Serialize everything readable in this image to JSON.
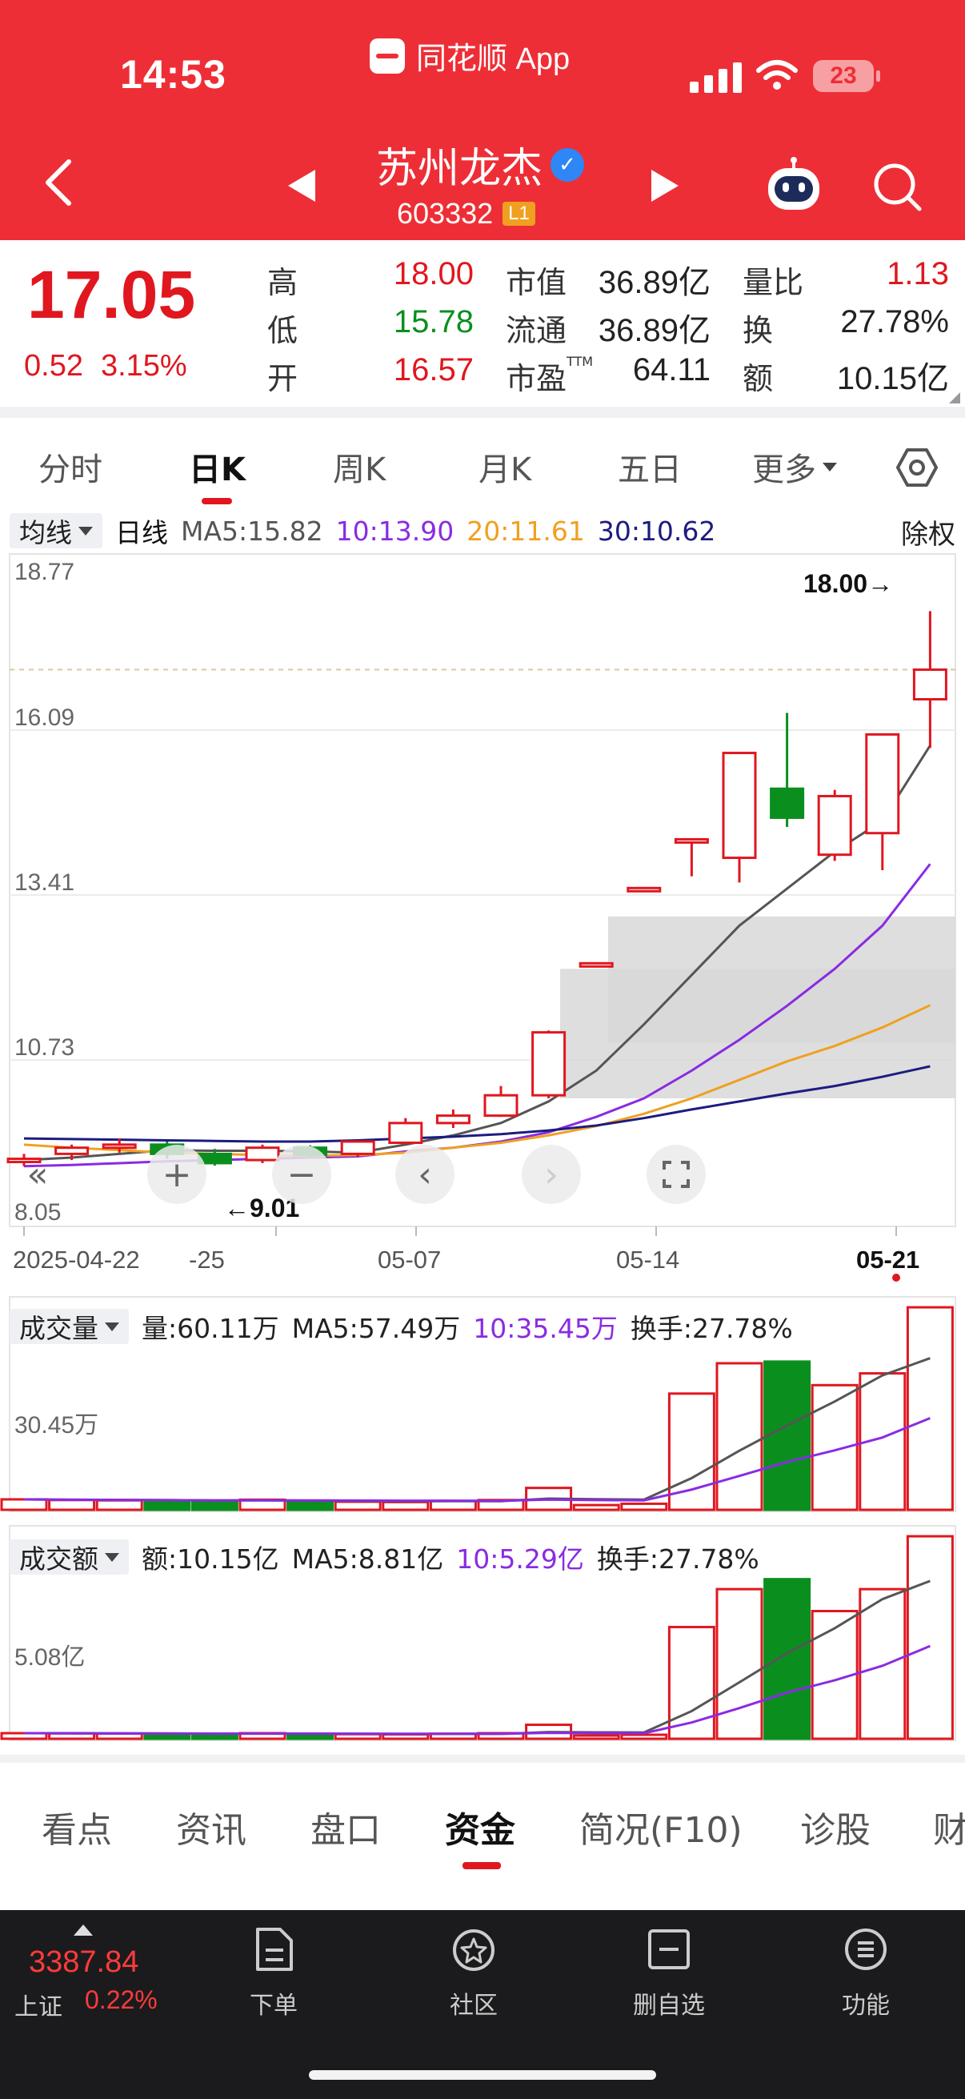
{
  "status_bar": {
    "time": "14:53",
    "app_name": "同花顺 App",
    "battery": "23"
  },
  "header": {
    "stock_name": "苏州龙杰",
    "stock_code": "603332",
    "level_badge": "L1",
    "verified_mark": "✓"
  },
  "quote": {
    "price": "17.05",
    "change": "0.52",
    "change_pct": "3.15%",
    "high_label": "高",
    "high": "18.00",
    "low_label": "低",
    "low": "15.78",
    "open_label": "开",
    "open": "16.57",
    "mcap_label": "市值",
    "mcap": "36.89亿",
    "float_label": "流通",
    "float": "36.89亿",
    "pe_label": "市盈",
    "pe_sup": "TTM",
    "pe": "64.11",
    "volratio_label": "量比",
    "volratio": "1.13",
    "turnover_label": "换",
    "turnover": "27.78%",
    "amount_label": "额",
    "amount": "10.15亿"
  },
  "period_tabs": [
    "分时",
    "日K",
    "周K",
    "月K",
    "五日",
    "更多"
  ],
  "period_active": "日K",
  "kline_legend": {
    "dropdown": "均线",
    "period": "日线",
    "ma5": "MA5:15.82",
    "ma10": "10:13.90",
    "ma20": "20:11.61",
    "ma30": "30:10.62",
    "fuquan": "除权"
  },
  "colors": {
    "up": "#e0171f",
    "down": "#0a8f1e",
    "ma5": "#555555",
    "ma10": "#8a2be2",
    "ma20": "#f0a020",
    "ma30": "#1c1c80",
    "header": "#ee2e36"
  },
  "icons": {
    "back": "chevron-left-icon",
    "prev": "triangle-left-icon",
    "next": "triangle-right-icon",
    "assistant": "robot-icon",
    "search": "search-icon",
    "settings": "hexagon-settings-icon"
  },
  "chart_data": [
    {
      "type": "candlestick",
      "title": "",
      "y_ticks": [
        "18.77",
        "16.09",
        "13.41",
        "10.73",
        "8.05"
      ],
      "ylim": [
        8.05,
        18.77
      ],
      "x_ticks": [
        "2025-04-22",
        "-25",
        "05-07",
        "05-14",
        "05-21"
      ],
      "high_marker": "18.00→",
      "low_marker": "←9.01",
      "candles": [
        {
          "o": 9.1,
          "h": 9.2,
          "l": 9.0,
          "c": 9.12
        },
        {
          "o": 9.2,
          "h": 9.35,
          "l": 9.1,
          "c": 9.3
        },
        {
          "o": 9.3,
          "h": 9.45,
          "l": 9.22,
          "c": 9.35
        },
        {
          "o": 9.35,
          "h": 9.4,
          "l": 9.12,
          "c": 9.2
        },
        {
          "o": 9.2,
          "h": 9.28,
          "l": 9.01,
          "c": 9.05
        },
        {
          "o": 9.1,
          "h": 9.35,
          "l": 9.05,
          "c": 9.3
        },
        {
          "o": 9.3,
          "h": 9.34,
          "l": 9.12,
          "c": 9.18
        },
        {
          "o": 9.2,
          "h": 9.42,
          "l": 9.15,
          "c": 9.4
        },
        {
          "o": 9.38,
          "h": 9.78,
          "l": 9.36,
          "c": 9.7
        },
        {
          "o": 9.7,
          "h": 9.92,
          "l": 9.62,
          "c": 9.82
        },
        {
          "o": 9.82,
          "h": 10.3,
          "l": 9.8,
          "c": 10.15
        },
        {
          "o": 10.15,
          "h": 11.2,
          "l": 10.1,
          "c": 11.17
        },
        {
          "o": 12.28,
          "h": 12.28,
          "l": 12.28,
          "c": 12.29
        },
        {
          "o": 13.5,
          "h": 13.5,
          "l": 13.5,
          "c": 13.51
        },
        {
          "o": 14.3,
          "h": 14.3,
          "l": 13.7,
          "c": 14.3
        },
        {
          "o": 14.0,
          "h": 15.7,
          "l": 13.6,
          "c": 15.7
        },
        {
          "o": 15.12,
          "h": 16.35,
          "l": 14.5,
          "c": 14.65
        },
        {
          "o": 14.05,
          "h": 15.1,
          "l": 13.95,
          "c": 15.0
        },
        {
          "o": 14.4,
          "h": 15.9,
          "l": 13.8,
          "c": 16.0
        },
        {
          "o": 16.57,
          "h": 18.0,
          "l": 15.78,
          "c": 17.05
        }
      ],
      "ma_series": [
        {
          "name": "MA5",
          "values": [
            9.1,
            9.14,
            9.2,
            9.26,
            9.25,
            9.25,
            9.24,
            9.22,
            9.35,
            9.5,
            9.7,
            10.05,
            10.55,
            11.3,
            12.1,
            12.9,
            13.5,
            14.1,
            14.6,
            15.82
          ]
        },
        {
          "name": "10",
          "values": [
            9.0,
            9.02,
            9.05,
            9.08,
            9.1,
            9.12,
            9.14,
            9.16,
            9.24,
            9.3,
            9.4,
            9.55,
            9.8,
            10.1,
            10.55,
            11.05,
            11.6,
            12.2,
            12.9,
            13.9
          ]
        },
        {
          "name": "20",
          "values": [
            9.35,
            9.3,
            9.26,
            9.22,
            9.2,
            9.18,
            9.17,
            9.18,
            9.22,
            9.3,
            9.38,
            9.5,
            9.65,
            9.85,
            10.1,
            10.4,
            10.7,
            10.95,
            11.25,
            11.61
          ]
        },
        {
          "name": "30",
          "values": [
            9.45,
            9.44,
            9.43,
            9.42,
            9.41,
            9.4,
            9.4,
            9.42,
            9.45,
            9.48,
            9.52,
            9.58,
            9.66,
            9.78,
            9.92,
            10.05,
            10.18,
            10.3,
            10.45,
            10.62
          ]
        }
      ]
    },
    {
      "type": "bar",
      "title": "成交量",
      "y_tick": "30.45万",
      "values": [
        3.1,
        2.9,
        2.8,
        2.7,
        2.5,
        3.0,
        2.6,
        2.4,
        2.3,
        2.6,
        2.9,
        6.5,
        1.4,
        1.8,
        34.5,
        43.5,
        44.0,
        37.0,
        40.5,
        60.11
      ]
    },
    {
      "type": "bar",
      "title": "成交额",
      "y_tick": "5.08亿",
      "values": [
        0.28,
        0.27,
        0.26,
        0.25,
        0.23,
        0.28,
        0.24,
        0.23,
        0.22,
        0.25,
        0.28,
        0.7,
        0.15,
        0.2,
        5.6,
        7.5,
        8.0,
        6.4,
        7.5,
        10.15
      ]
    }
  ],
  "volume_legend": {
    "dropdown": "成交量",
    "vol": "量:60.11万",
    "ma5": "MA5:57.49万",
    "ma10": "10:35.45万",
    "turnover": "换手:27.78%"
  },
  "amount_legend": {
    "dropdown": "成交额",
    "amt": "额:10.15亿",
    "ma5": "MA5:8.81亿",
    "ma10": "10:5.29亿",
    "turnover": "换手:27.78%"
  },
  "bottom_tabs": [
    "看点",
    "资讯",
    "盘口",
    "资金",
    "简况(F10)",
    "诊股",
    "财"
  ],
  "bottom_tab_active": "资金",
  "bottom_nav": {
    "index_value": "3387.84",
    "index_name": "上证",
    "index_pct": "0.22%",
    "items": [
      "下单",
      "社区",
      "删自选",
      "功能"
    ]
  }
}
